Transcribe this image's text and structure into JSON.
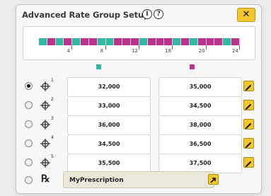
{
  "dialog": {
    "title": "Advanced Rate Group Setup",
    "info_icon_1": "i",
    "info_icon_2": "?",
    "close_label": "✕"
  },
  "timeline": {
    "segments": [
      "teal",
      "magenta",
      "teal",
      "magenta",
      "teal",
      "magenta",
      "magenta",
      "teal",
      "teal",
      "magenta",
      "magenta",
      "magenta",
      "teal",
      "magenta",
      "magenta",
      "magenta",
      "teal",
      "magenta",
      "teal",
      "magenta",
      "magenta",
      "magenta",
      "teal",
      "magenta"
    ],
    "tick_labels": [
      "4",
      "8",
      "12",
      "16",
      "20",
      "24"
    ]
  },
  "colors": {
    "teal": "#35b8a2",
    "magenta": "#b9358d",
    "button_yellow": "#f2c62c"
  },
  "table": {
    "rows": [
      {
        "index": "1",
        "teal_value": "32,000",
        "magenta_value": "35,000",
        "selected": true
      },
      {
        "index": "2",
        "teal_value": "33,000",
        "magenta_value": "34,500",
        "selected": false
      },
      {
        "index": "3",
        "teal_value": "36,000",
        "magenta_value": "38,000",
        "selected": false
      },
      {
        "index": "4",
        "teal_value": "34,500",
        "magenta_value": "36,500",
        "selected": false
      },
      {
        "index": "5",
        "teal_value": "35,500",
        "magenta_value": "37,500",
        "selected": false
      }
    ],
    "prescription_symbol": "℞",
    "prescription_name": "MyPrescription"
  }
}
